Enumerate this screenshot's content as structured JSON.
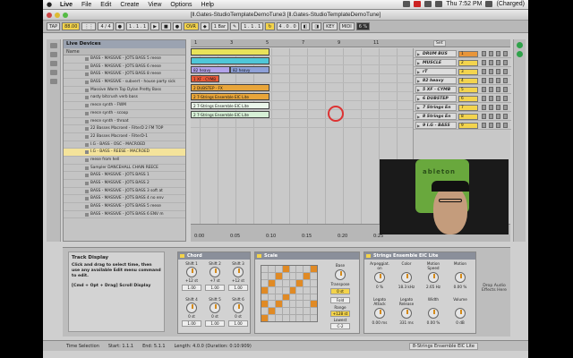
{
  "menubar": {
    "items": [
      "Live",
      "File",
      "Edit",
      "Create",
      "View",
      "Options",
      "Help"
    ],
    "clock": "Thu 7:52 PM",
    "battery": "(Charged)"
  },
  "window": {
    "title": "[ll.Gates-StudioTemplateDemoTune3   [ll.Gates-StudioTemplateDemoTune]"
  },
  "transport": {
    "tap": "TAP",
    "tempo": "88.00",
    "sig": "4 / 4",
    "ovr": "OVR",
    "quant": "1 Bar",
    "pos": "1 . 1 . 1",
    "loop_len": "4 . 0 . 0",
    "key": "KEY",
    "midi": "MIDI",
    "cpu": "6 %"
  },
  "browser": {
    "title": "Live Devices",
    "col_header": "Name",
    "items": [
      "BASS - MASSIVE - JOTS BASS 5 reese",
      "BASS - MASSIVE - JOTS BASS 6 reese",
      "BASS - MASSIVE - JOTS BASS 8 reese",
      "BASS - MASSIVE - subvert - house party sick",
      "Massive Warm Top Dylan Pretty Bass",
      "nasty bitcrush verb bass",
      "reece synth - FWM",
      "reece synth - scoop",
      "reece synth - throat",
      "22 Basses Macroed - FilterD 2 FM TOP",
      "22 Basses Macroed - FilterD-1",
      "I.G - BASS - OSC - MACROED",
      "I.G - BASS - REESE - MACROED",
      "reese from hell",
      "Sampler DANCEHALL CHAIN REECE",
      "BASS - MASSIVE - JOTS BASS 1",
      "BASS - MASSIVE - JOTS BASS 2",
      "BASS - MASSIVE - JOTS BASS 3 soft at",
      "BASS - MASSIVE - JOTS BASS 4 no env",
      "BASS - MASSIVE - JOTS BASS 5 reese",
      "BASS - MASSIVE - JOTS BASS 6 ENV m"
    ],
    "selected_index": 12
  },
  "arrangement": {
    "ruler": [
      "1",
      "3",
      "5",
      "7",
      "9",
      "11"
    ],
    "timeline": [
      "0:00",
      "0:05",
      "0:10",
      "0:15",
      "0:20",
      "0:25"
    ],
    "clips": [
      {
        "lane": 0,
        "label": "",
        "color": "#e8e25a"
      },
      {
        "lane": 1,
        "label": "",
        "color": "#4fc7d8"
      },
      {
        "lane": 2,
        "label": "82 heavy",
        "color": "#b2a2ea"
      },
      {
        "lane": 2,
        "label": "82 heavy",
        "color": "#8ea0d8"
      },
      {
        "lane": 3,
        "label": "1 XF · CYMB",
        "color": "#e85a3a"
      },
      {
        "lane": 4,
        "label": "2 DUBSTEP · FX",
        "color": "#e8a53a"
      },
      {
        "lane": 5,
        "label": "2 7-Strings Ensemble EIC Lite",
        "color": "#e8a53a"
      },
      {
        "lane": 6,
        "label": "2 7-Strings Ensemble EIC Lite",
        "color": "#eaf6ea"
      },
      {
        "lane": 7,
        "label": "2 7-Strings Ensemble EIC Lite",
        "color": "#d6f0d6"
      }
    ],
    "tracks": [
      {
        "name": "DRUM BUS",
        "vol": "1",
        "color": "#e8953a"
      },
      {
        "name": "MUSCLE",
        "vol": "2",
        "color": "#f3d44e"
      },
      {
        "name": "rT",
        "vol": "3",
        "color": "#f3d44e"
      },
      {
        "name": "82 heavy",
        "vol": "4",
        "color": "#f3d44e"
      },
      {
        "name": "5 XF · CYMB",
        "vol": "5",
        "color": "#f3d44e"
      },
      {
        "name": "6 DUBSTEP",
        "vol": "6",
        "color": "#f3d44e"
      },
      {
        "name": "7 Strings En",
        "vol": "7",
        "color": "#f3d44e"
      },
      {
        "name": "8 Strings En",
        "vol": "8",
        "color": "#f3d44e"
      },
      {
        "name": "9 I.G - BASS",
        "vol": "9",
        "color": "#f3d44e"
      }
    ],
    "set_label": "Set"
  },
  "webcam": {
    "logo": "ableton"
  },
  "detail": {
    "info_title": "Track Display",
    "info_text": "Click and drag to select time, then use any available Edit menu command to edit.",
    "info_text2": "[Cmd + Opt + Drag] Scroll Display",
    "chord": {
      "title": "Chord",
      "shifts": [
        {
          "label": "Shift 1",
          "val": "+12 st",
          "vel": "1.00"
        },
        {
          "label": "Shift 2",
          "val": "+7 st",
          "vel": "1.00"
        },
        {
          "label": "Shift 3",
          "val": "+12 st",
          "vel": "1.00"
        },
        {
          "label": "Shift 4",
          "val": "0 st",
          "vel": "1.00"
        },
        {
          "label": "Shift 5",
          "val": "0 st",
          "vel": "1.00"
        },
        {
          "label": "Shift 6",
          "val": "0 st",
          "vel": "1.00"
        }
      ]
    },
    "scale": {
      "title": "Scale",
      "base_label": "Base",
      "base_val": "C",
      "transpose_label": "Transpose",
      "transpose_val": "0 st",
      "fold_label": "Fold",
      "range_label": "Range",
      "range_val": "+128 st",
      "lowest_label": "Lowest",
      "lowest_val": "C-2"
    },
    "instrument": {
      "title": "Strings Ensemble EIC Lite",
      "knobs": [
        {
          "label": "Arpeggiat. on",
          "val": "0 %"
        },
        {
          "label": "Color",
          "val": "18.3 kHz"
        },
        {
          "label": "Motion Speed",
          "val": "2.65 Hz"
        },
        {
          "label": "Motion",
          "val": "0.00 %"
        },
        {
          "label": "Legato Attack",
          "val": "0.00 ms"
        },
        {
          "label": "Legato Release",
          "val": "331 ms"
        },
        {
          "label": "Width",
          "val": "0.00 %"
        },
        {
          "label": "Volume",
          "val": "0 dB"
        }
      ]
    },
    "drop_text": "Drop Audio Effects Here"
  },
  "statusbar": {
    "label": "Time Selection",
    "start": "Start: 1.1.1",
    "end": "End: 5.1.1",
    "length": "Length: 4.0.0 (Duration: 0:10:909)",
    "track": "8-Strings Ensemble EIC Lite"
  }
}
